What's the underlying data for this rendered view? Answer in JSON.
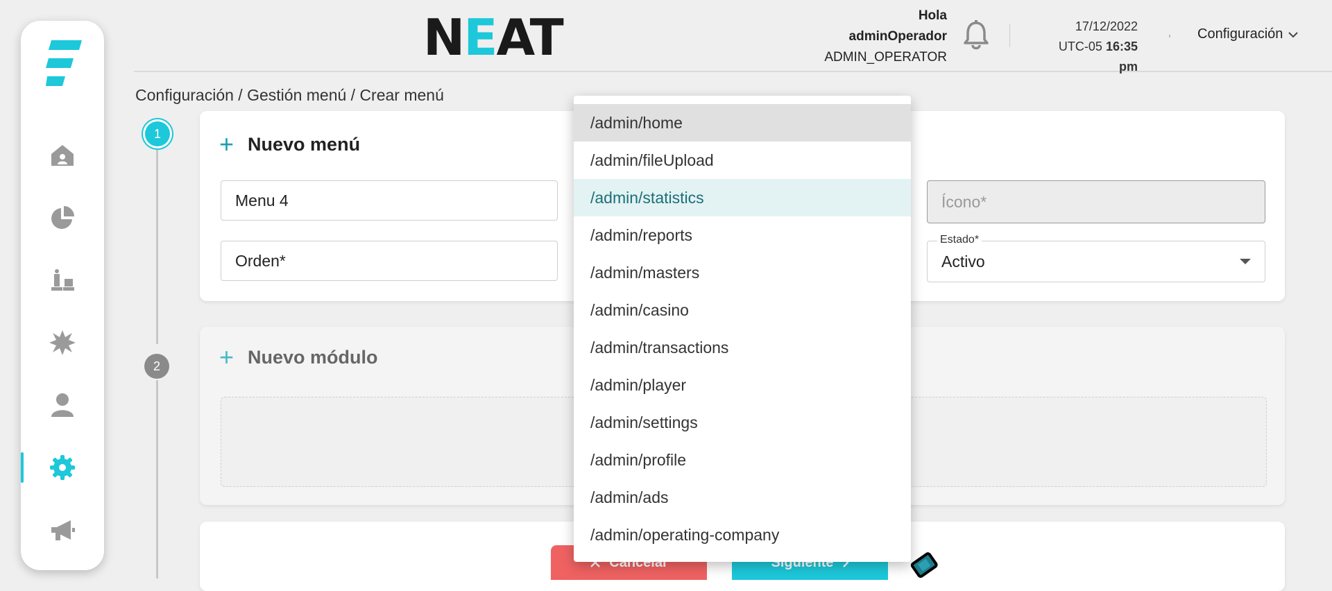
{
  "brand": {
    "name_left": "N",
    "name_e": "E",
    "name_right": "AT"
  },
  "user": {
    "greeting": "Hola",
    "username": "adminOperador",
    "role": "ADMIN_OPERATOR"
  },
  "datetime": {
    "date": "17/12/2022",
    "tz": "UTC-05",
    "time": "16:35 pm"
  },
  "header": {
    "config_label": "Configuración"
  },
  "breadcrumb": "Configuración / Gestión menú / Crear menú",
  "sidebar": {
    "items": [
      {
        "icon": "home-icon"
      },
      {
        "icon": "pie-chart-icon"
      },
      {
        "icon": "chess-icon"
      },
      {
        "icon": "starburst-icon"
      },
      {
        "icon": "user-icon"
      },
      {
        "icon": "gear-icon",
        "active": true
      },
      {
        "icon": "megaphone-icon"
      }
    ]
  },
  "steps": {
    "one": "1",
    "two": "2"
  },
  "form": {
    "title": "Nuevo menú",
    "name_value": "Menu 4",
    "order_placeholder": "Orden*",
    "icon_placeholder": "Ícono*",
    "status_label": "Estado*",
    "status_value": "Activo"
  },
  "module": {
    "title": "Nuevo módulo"
  },
  "buttons": {
    "cancel": "Cancelar",
    "next": "Siguiente"
  },
  "dropdown": {
    "options": [
      "/admin/home",
      "/admin/fileUpload",
      "/admin/statistics",
      "/admin/reports",
      "/admin/masters",
      "/admin/casino",
      "/admin/transactions",
      "/admin/player",
      "/admin/settings",
      "/admin/profile",
      "/admin/ads",
      "/admin/operating-company"
    ],
    "hover_index": 0,
    "selected_index": 2
  },
  "colors": {
    "accent": "#1cc8da",
    "danger": "#f06262",
    "icon_gray": "#9a9a9a"
  }
}
